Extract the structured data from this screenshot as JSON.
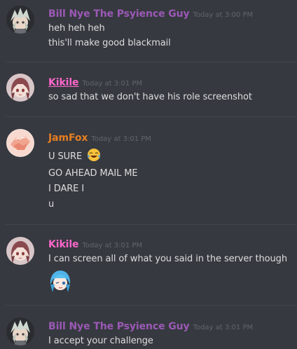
{
  "colors": {
    "background": "#36393f",
    "divider": "#42454a",
    "message_text": "#dcddde",
    "timestamp": "#62656b",
    "bill_name": "#9b59b6",
    "kikile_name": "#ff66cc",
    "jamfox_name": "#e67e22"
  },
  "messages": [
    {
      "author": "Bill Nye The Psyience Guy",
      "timestamp": "Today at 3:00 PM",
      "avatar_icon": "anime-avatar-white-hair",
      "lines": [
        "heh heh heh",
        "this'll make good blackmail"
      ]
    },
    {
      "author": "Kikile",
      "timestamp": "Today at 3:01 PM",
      "avatar_icon": "anime-avatar-brown-hair",
      "lines": [
        "so sad that we don't have his role screenshot"
      ]
    },
    {
      "author": "JamFox",
      "timestamp": "Today at 3:01 PM",
      "avatar_icon": "avatar-hands-orange",
      "lines": [
        "U SURE",
        "GO AHEAD MAIL ME",
        "I DARE I",
        "u"
      ],
      "emoji": "joy-emoji"
    },
    {
      "author": "Kikile",
      "timestamp": "Today at 3:01 PM",
      "avatar_icon": "anime-avatar-brown-hair",
      "lines": [
        "I can screen all of what you said in the server though"
      ],
      "sticker": "anime-wink-emote"
    },
    {
      "author": "Bill Nye The Psyience Guy",
      "timestamp": "Today at 3:01 PM",
      "avatar_icon": "anime-avatar-white-hair",
      "lines": [
        "I accept your challenge"
      ]
    }
  ]
}
